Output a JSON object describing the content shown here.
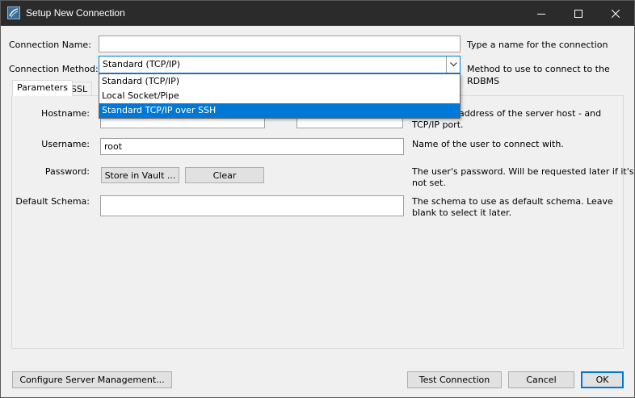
{
  "window": {
    "title": "Setup New Connection"
  },
  "connection_name": {
    "label": "Connection Name:",
    "value": "",
    "hint": "Type a name for the connection"
  },
  "connection_method": {
    "label": "Connection Method:",
    "value": "Standard (TCP/IP)",
    "hint": "Method to use to connect to the RDBMS",
    "options": [
      "Standard (TCP/IP)",
      "Local Socket/Pipe",
      "Standard TCP/IP over SSH"
    ],
    "highlighted_option": "Standard TCP/IP over SSH"
  },
  "tabs": [
    {
      "label": "Parameters",
      "active": true
    },
    {
      "label": "SSL",
      "active": false
    }
  ],
  "parameters": {
    "hostname": {
      "label": "Hostname:",
      "value": "",
      "port_value": "",
      "hint_line1": "address of the server host - and",
      "hint_line2": "TCP/IP port."
    },
    "username": {
      "label": "Username:",
      "value": "root",
      "hint": "Name of the user to connect with."
    },
    "password": {
      "label": "Password:",
      "store_button": "Store in Vault ...",
      "clear_button": "Clear",
      "hint_line1": "The user's password. Will be requested later if it's",
      "hint_line2": "not set."
    },
    "default_schema": {
      "label": "Default Schema:",
      "value": "",
      "hint_line1": "The schema to use as default schema. Leave",
      "hint_line2": "blank to select it later."
    }
  },
  "footer": {
    "configure_button": "Configure Server Management...",
    "test_button": "Test Connection",
    "cancel_button": "Cancel",
    "ok_button": "OK"
  },
  "colors": {
    "titlebar": "#2b2b2b",
    "accent": "#0078d7",
    "background": "#f0f0f0"
  }
}
